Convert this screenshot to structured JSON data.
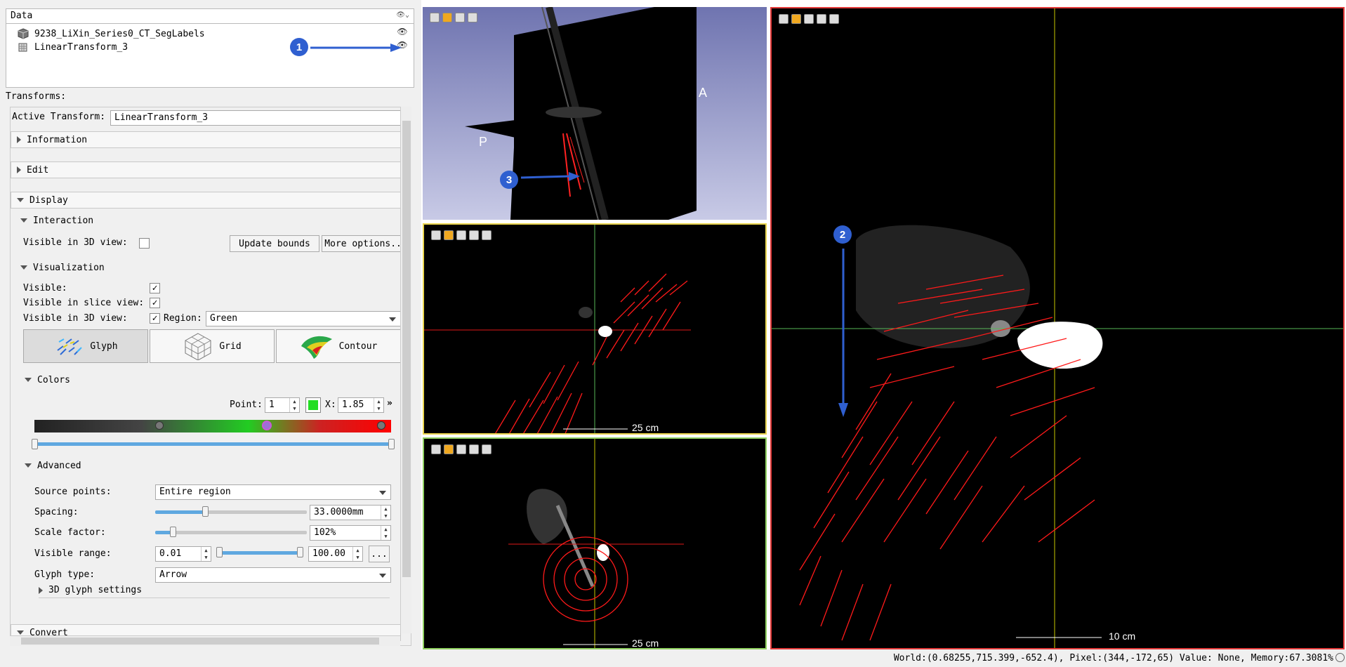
{
  "data_panel": {
    "header": "Data",
    "header_icons": "eye-icon, chevron-icon",
    "nodes": [
      {
        "name": "9238_LiXin_Series0_CT_SegLabels",
        "icon": "segmentation-icon",
        "visible": true
      },
      {
        "name": "LinearTransform_3",
        "icon": "transform-icon",
        "visible": true
      }
    ]
  },
  "callouts": [
    "1",
    "2",
    "3"
  ],
  "transforms": {
    "label": "Transforms:",
    "active_label": "Active Transform:",
    "active_value": "LinearTransform_3",
    "sections": {
      "information": "Information",
      "edit": "Edit",
      "display": "Display",
      "convert": "Convert"
    },
    "interaction": {
      "title": "Interaction",
      "visible_3d_label": "Visible in 3D view:",
      "update_bounds": "Update bounds",
      "more_options": "More options..."
    },
    "visualization": {
      "title": "Visualization",
      "visible_label": "Visible:",
      "visible_slice_label": "Visible in slice view:",
      "visible_3d_label": "Visible in 3D view:",
      "region_label": "Region:",
      "region_value": "Green",
      "modes": [
        {
          "label": "Glyph",
          "icon": "glyph-icon",
          "active": true
        },
        {
          "label": "Grid",
          "icon": "grid-icon",
          "active": false
        },
        {
          "label": "Contour",
          "icon": "contour-icon",
          "active": false
        }
      ]
    },
    "colors": {
      "title": "Colors",
      "point_label": "Point:",
      "point_value": "1",
      "swatch": "#22dd22",
      "x_label": "X:",
      "x_value": "1.85",
      "more": "»",
      "gradient": [
        "#222222",
        "#777777",
        "#22cc22",
        "#cc2222",
        "#ff0000"
      ]
    },
    "advanced": {
      "title": "Advanced",
      "source_points_label": "Source points:",
      "source_points_value": "Entire region",
      "spacing_label": "Spacing:",
      "spacing_value": "33.0000mm",
      "scale_label": "Scale factor:",
      "scale_value": "102%",
      "range_label": "Visible range:",
      "range_min": "0.01",
      "range_max": "100.00",
      "range_btn": "...",
      "glyph_type_label": "Glyph type:",
      "glyph_type_value": "Arrow",
      "glyph3d_label": "3D glyph settings"
    }
  },
  "views": {
    "orient_labels": [
      "P",
      "A"
    ],
    "red_scale": "25 cm",
    "green_scale": "25 cm",
    "large_scale": "10 cm",
    "colors": {
      "red": "#e43a3a",
      "green": "#8fcf5f",
      "yellow": "#e8d44d",
      "arrows": "#ff1a1a",
      "crosshair_y": "#d4d000",
      "crosshair_g": "#58b858",
      "crosshair_r": "#e01818"
    }
  },
  "status": {
    "text": "World:(0.68255,715.399,-652.4), Pixel:(344,-172,65) Value: None,  Memory:67.3081%"
  }
}
